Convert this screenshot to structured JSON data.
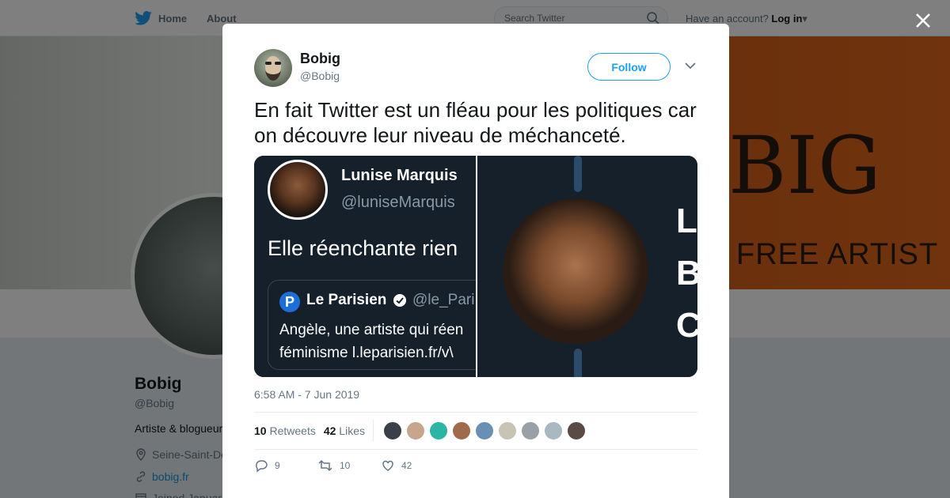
{
  "nav": {
    "home_label": "Home",
    "about_label": "About",
    "search_placeholder": "Search Twitter",
    "account_prompt": "Have an account?",
    "login_label": "Log in"
  },
  "banner": {
    "title_fragment": "BIG",
    "subtitle_fragment": "FREE ARTIST"
  },
  "profile": {
    "name": "Bobig",
    "handle": "@Bobig",
    "bio": "Artiste & blogueur",
    "location": "Seine-Saint-De",
    "website": "bobig.fr",
    "joined": "Joined Januar"
  },
  "tweet": {
    "author_name": "Bobig",
    "author_handle": "@Bobig",
    "follow_label": "Follow",
    "text": "En fait Twitter est un fléau pour les politiques car on découvre leur niveau de méchanceté.",
    "timestamp": "6:58 AM - 7 Jun 2019",
    "retweets_count": "10",
    "retweets_label": "Retweets",
    "likes_count": "42",
    "likes_label": "Likes",
    "replies_action": "9",
    "retweets_action": "10",
    "likes_action": "42"
  },
  "media": {
    "left": {
      "name": "Lunise Marquis",
      "handle": "@luniseMarquis",
      "text": "Elle réenchante rien",
      "quote_source_name": "Le Parisien",
      "quote_source_handle": "@le_Pari",
      "quote_line1": "Angèle, une artiste qui réen",
      "quote_line2": "féminisme l.leparisien.fr/v\\"
    },
    "right": {
      "letters": [
        "L",
        "B",
        "C"
      ]
    }
  },
  "likers": {
    "colors": [
      "#3a3f4a",
      "#c7a58e",
      "#2bb5a4",
      "#a06a4c",
      "#6a8fb4",
      "#c8c4b4",
      "#9aa0a8",
      "#aab8c2",
      "#5a4c44"
    ]
  },
  "colors": {
    "accent": "#1da1f2",
    "text": "#14171a",
    "muted": "#657786"
  }
}
